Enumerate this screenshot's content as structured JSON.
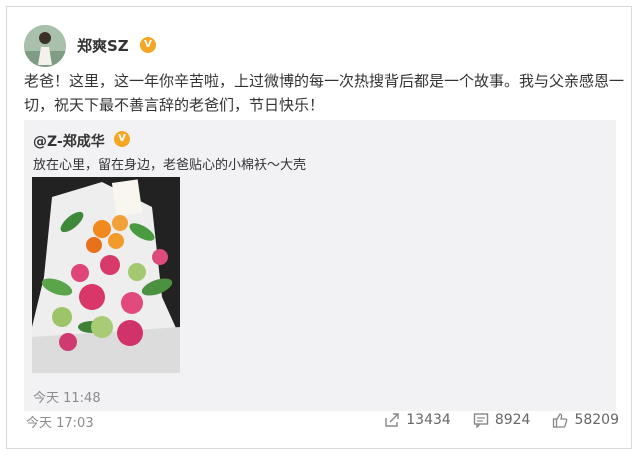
{
  "post": {
    "author": "郑爽SZ",
    "verified_badge": "V",
    "text": "老爸！这里，这一年你辛苦啦，上过微博的每一次热搜背后都是一个故事。我与父亲感恩一切，祝天下最不善言辞的老爸们，节日快乐！",
    "time": "今天 17:03"
  },
  "repost": {
    "author": "@Z-郑成华",
    "verified_badge": "V",
    "text": "放在心里，留在身边，老爸贴心的小棉袄～大壳",
    "time": "今天 11:48"
  },
  "actions": {
    "share_count": "13434",
    "comment_count": "8924",
    "like_count": "58209"
  },
  "icons": {
    "share": "share-icon",
    "comment": "comment-icon",
    "like": "like-icon"
  },
  "colors": {
    "verified": "#f5a623",
    "meta": "#8c8c8c",
    "repost_bg": "#f2f2f5"
  }
}
